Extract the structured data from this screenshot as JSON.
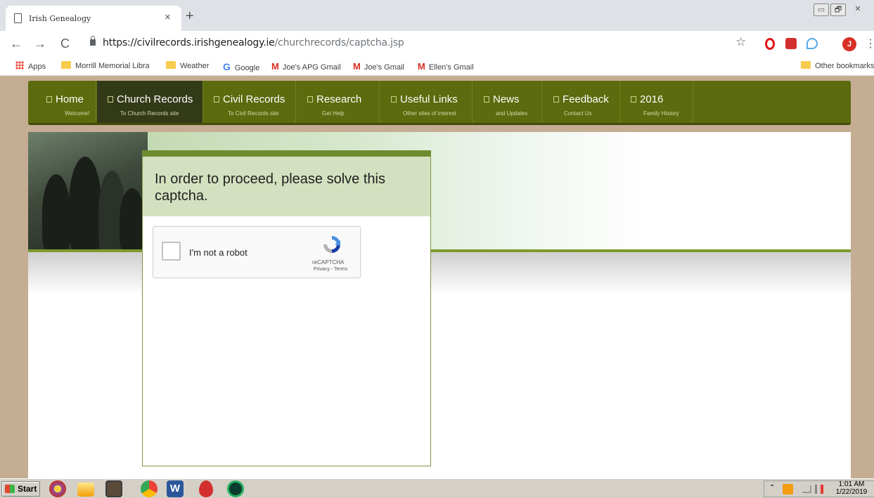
{
  "browser": {
    "tab_title": "Irish Genealogy",
    "tab_close": "×",
    "new_tab": "+",
    "window_controls": [
      "▭",
      "🗗",
      "✕"
    ],
    "nav": {
      "back": "←",
      "forward": "→",
      "reload": "C"
    },
    "url_scheme": "https://",
    "url_host": "civilrecords.irishgenealogy.ie",
    "url_path": "/churchrecords/captcha.jsp",
    "bookmark_star": "☆",
    "profile_initial": "J",
    "menu": "⋮",
    "bookmarks": [
      {
        "label": "Apps",
        "icon": "apps-grid-icon"
      },
      {
        "label": "Morrill Memorial Library",
        "icon": "folder-icon"
      },
      {
        "label": "Weather",
        "icon": "folder-icon"
      },
      {
        "label": "Google",
        "icon": "google-icon"
      },
      {
        "label": "Joe's APG Gmail",
        "icon": "gmail-icon"
      },
      {
        "label": "Joe's Gmail",
        "icon": "gmail-icon"
      },
      {
        "label": "Ellen's Gmail",
        "icon": "gmail-icon"
      }
    ],
    "other_bookmarks": "Other bookmarks",
    "icon_glyphs": {
      "google": "G",
      "gmail": "M"
    }
  },
  "site_nav": [
    {
      "label": "Home",
      "sub": "Welcome!"
    },
    {
      "label": "Church Records",
      "sub": "To Church Records site"
    },
    {
      "label": "Civil Records",
      "sub": "To Civil Records site"
    },
    {
      "label": "Research",
      "sub": "Get Help"
    },
    {
      "label": "Useful Links",
      "sub": "Other sites of interest"
    },
    {
      "label": "News",
      "sub": "and Updates"
    },
    {
      "label": "Feedback",
      "sub": "Contact Us"
    },
    {
      "label": "2016",
      "sub": "Family History"
    }
  ],
  "captcha": {
    "message": "In order to proceed, please solve this captcha.",
    "checkbox_label": "I'm not a robot",
    "brand": "reCAPTCHA",
    "terms": "Privacy - Terms"
  },
  "taskbar": {
    "start": "Start",
    "time": "1:01 AM",
    "date": "1/22/2019",
    "tray_expand": "⌃"
  },
  "colors": {
    "nav_bg": "#5b6b0d",
    "nav_active": "#323a17",
    "page_bg": "#c4ad93",
    "modal_header": "#d4e1c0",
    "accent_green": "#6c8b2f"
  }
}
